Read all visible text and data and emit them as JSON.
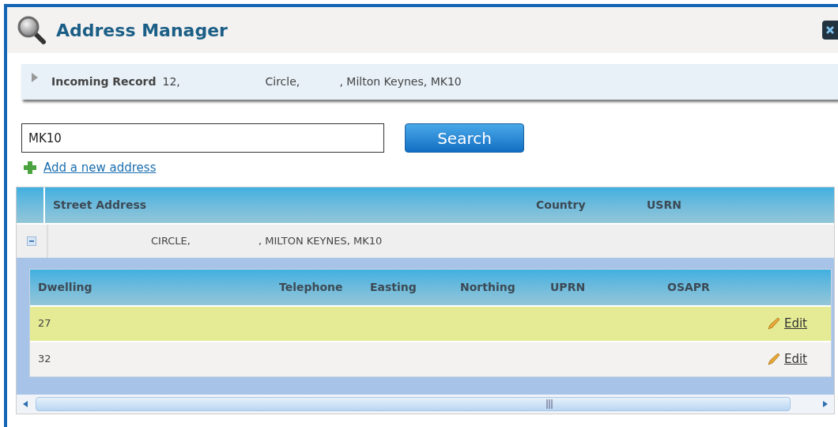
{
  "window": {
    "title": "Address Manager"
  },
  "incoming_record": {
    "label": "Incoming Record",
    "expanded": false,
    "parts": [
      "12,",
      "Circle,",
      ", Milton Keynes, MK10"
    ]
  },
  "search": {
    "value": "MK10",
    "button": "Search"
  },
  "add_link": "Add a new address",
  "table": {
    "columns": [
      "Street Address",
      "Country",
      "USRN"
    ],
    "rows": [
      {
        "expanded": true,
        "parts": [
          "CIRCLE,",
          ", MILTON KEYNES, MK10"
        ],
        "detail": {
          "columns": [
            "Dwelling",
            "Telephone",
            "Easting",
            "Northing",
            "UPRN",
            "OSAPR"
          ],
          "rows": [
            {
              "dwelling": "27",
              "selected": true,
              "action": "Edit"
            },
            {
              "dwelling": "32",
              "selected": false,
              "action": "Edit"
            }
          ]
        }
      }
    ]
  }
}
